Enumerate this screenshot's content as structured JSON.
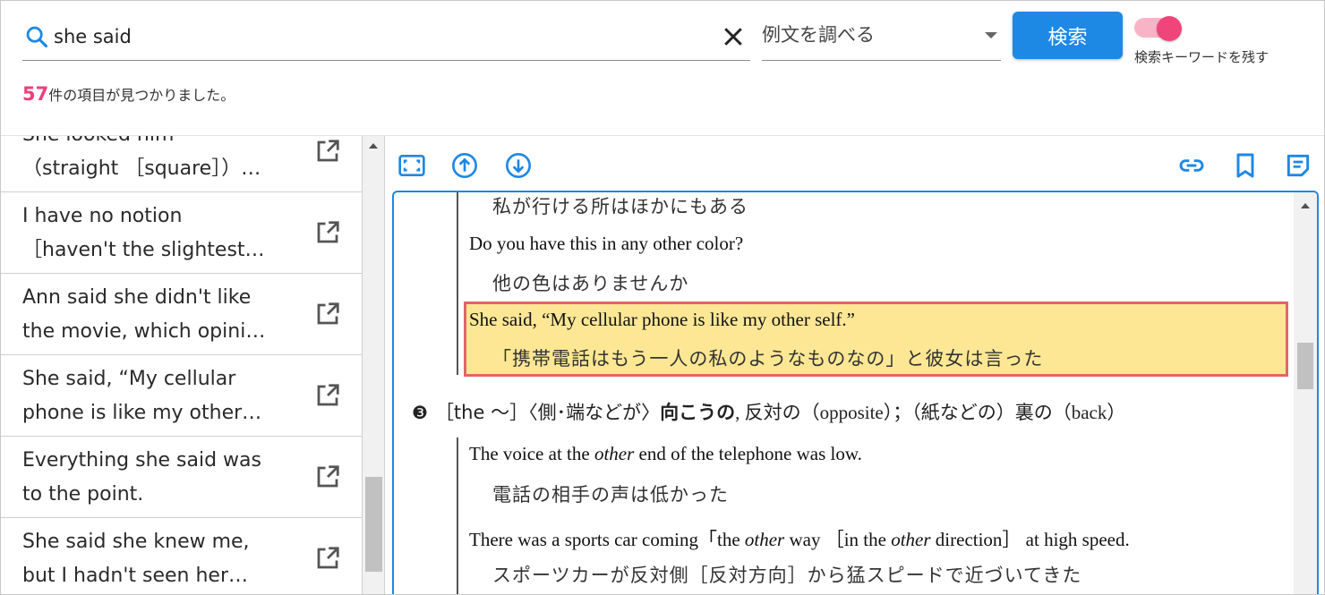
{
  "search": {
    "value": "she said",
    "mode_selected": "例文を調べる",
    "button_label": "検索",
    "toggle_label": "検索キーワードを残す",
    "toggle_on": true
  },
  "results": {
    "count": "57",
    "count_suffix": "件の項目が見つかりました。"
  },
  "list": [
    {
      "line1": "She looked him",
      "line2": "（straight ［square］）…"
    },
    {
      "line1": "I have no notion",
      "line2": "［haven't the slightest…"
    },
    {
      "line1": "Ann said she didn't like",
      "line2": "the movie, which opini…"
    },
    {
      "line1": "She said, “My cellular",
      "line2": "phone is like my other…"
    },
    {
      "line1": "Everything she said was",
      "line2": "to the point."
    },
    {
      "line1": "She said she knew me,",
      "line2": "but I hadn't seen her…"
    }
  ],
  "toolbar": {
    "left": [
      "fit-screen-icon",
      "arrow-up-circle-icon",
      "arrow-down-circle-icon"
    ],
    "right": [
      "link-icon",
      "bookmark-icon",
      "note-icon"
    ]
  },
  "content": {
    "ex0_ja": "私が行ける所はほかにもある",
    "ex1_en": "Do you have this in any other color?",
    "ex1_ja": "他の色はありませんか",
    "ex2_en": "She said, “My cellular phone is like my other self.”",
    "ex2_ja": "「携帯電話はもう一人の私のようなものなの」と彼女は言った",
    "sense3": {
      "num": "❸",
      "pre": "［the ～］〈側･端などが〉",
      "head": "向こうの",
      "post": ", 反対の（opposite）；（紙などの）裏の（back）"
    },
    "ex3_en_a": "The voice at the ",
    "ex3_en_em": "other",
    "ex3_en_b": " end of the telephone was low.",
    "ex3_ja": "電話の相手の声は低かった",
    "ex4_en_a": "There was a sports car coming「the ",
    "ex4_en_em1": "other",
    "ex4_en_b": " way ［in the ",
    "ex4_en_em2": "other",
    "ex4_en_c": " direction］ at high speed.",
    "ex4_ja": "スポーツカーが反対側［反対方向］から猛スピードで近づいてきた"
  },
  "colors": {
    "accent": "#1e88e5",
    "count": "#ec407a",
    "highlight_bg": "#fde794",
    "highlight_border": "#e06666",
    "toggle": "#f0457a"
  }
}
